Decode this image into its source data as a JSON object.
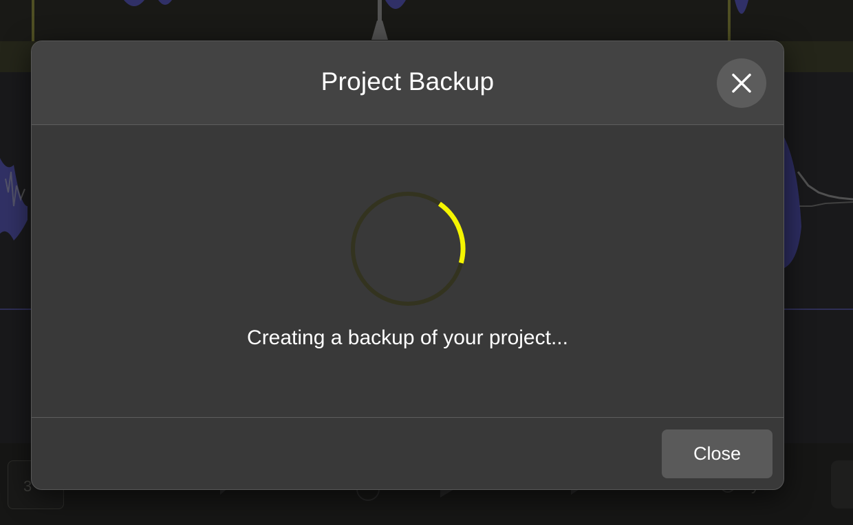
{
  "dialog": {
    "title": "Project Backup",
    "status": "Creating a backup of your project...",
    "close_label": "Close",
    "accent_color": "#f5f500",
    "progress_indicator": "indeterminate-spinner"
  },
  "background": {
    "counter_text": "3",
    "sync_label": "ync"
  },
  "icons": {
    "close": "close-icon",
    "spinner": "loading-spinner-icon"
  }
}
